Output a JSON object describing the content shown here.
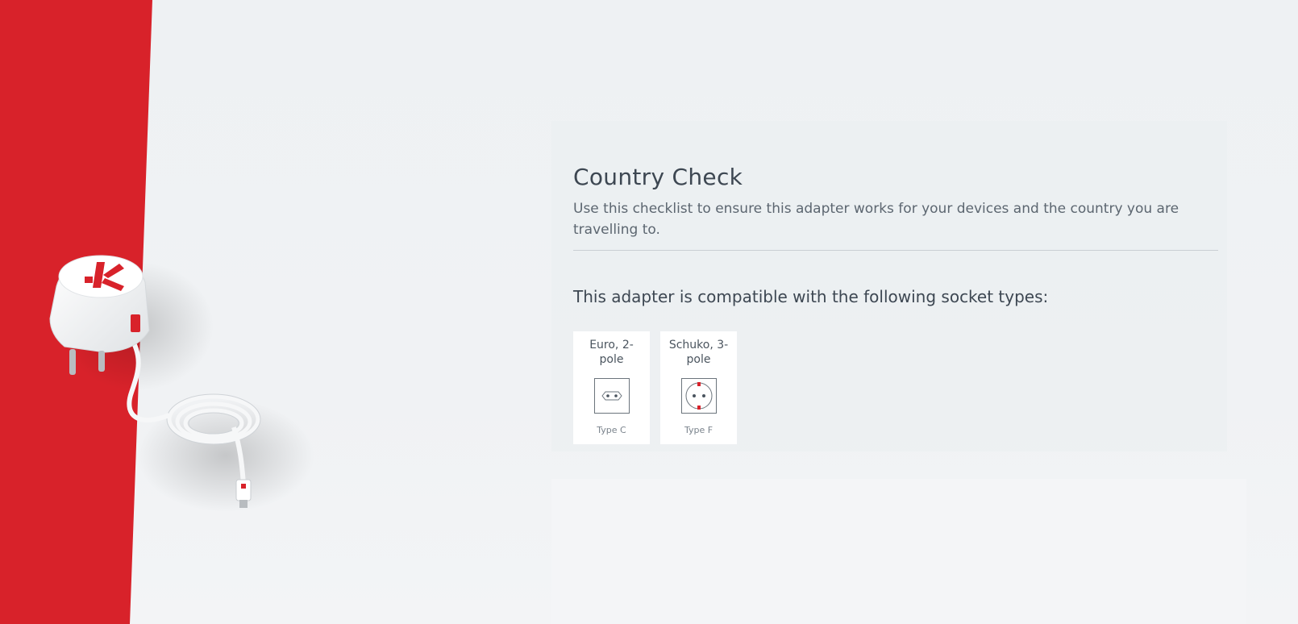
{
  "country_check": {
    "title": "Country Check",
    "subtitle": "Use this checklist to ensure this adapter works for your devices and the country you are travelling to.",
    "compat_heading": "This adapter is compatible with the following socket types:"
  },
  "sockets": [
    {
      "name": "Euro, 2-pole",
      "type": "Type C",
      "icon": "euro-2-pole-socket-icon"
    },
    {
      "name": "Schuko, 3-pole",
      "type": "Type F",
      "icon": "schuko-3-pole-socket-icon"
    }
  ],
  "colors": {
    "brand_red": "#d8222a",
    "background": "#eef1f3",
    "text": "#3d4752"
  }
}
